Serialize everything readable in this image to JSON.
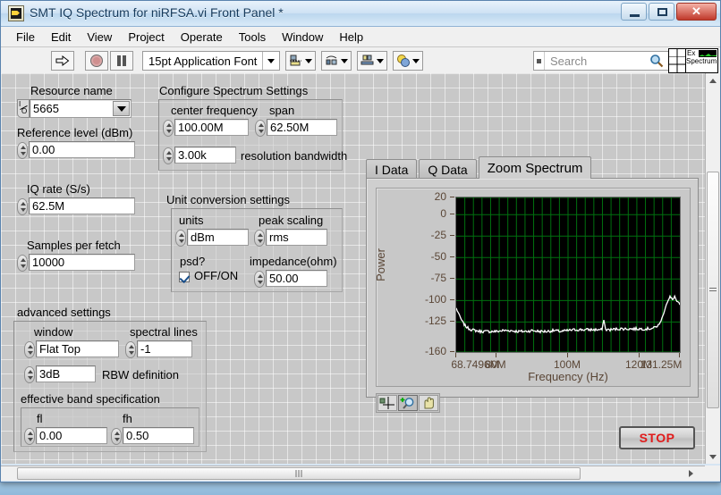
{
  "window": {
    "title": "SMT IQ Spectrum for niRFSA.vi Front Panel *",
    "icon_name": "labview-vi-icon",
    "minimize_label": "–",
    "maximize_label": "□",
    "close_label": "✕"
  },
  "menu": [
    "File",
    "Edit",
    "View",
    "Project",
    "Operate",
    "Tools",
    "Window",
    "Help"
  ],
  "toolbar": {
    "run_icon": "run-arrow-icon",
    "abort_icon": "abort-stop-icon",
    "pause_icon": "pause-icon",
    "font_selector": "15pt Application Font",
    "align_icon": "align-objects-icon",
    "distribute_icon": "distribute-objects-icon",
    "resize_icon": "resize-objects-icon",
    "reorder_icon": "reorder-objects-icon",
    "search_placeholder": "Search",
    "search_value": "",
    "search_icon": "magnifier-icon",
    "help_icon": "context-help-icon",
    "vi_icon_line1": "Ex",
    "vi_icon_line2": "Spectrum"
  },
  "controls": {
    "resource_name": {
      "label": "Resource name",
      "value": "5665",
      "type": "io-name-combo"
    },
    "reference_level": {
      "label": "Reference level (dBm)",
      "value": "0.00"
    },
    "iq_rate": {
      "label": "IQ rate (S/s)",
      "value": "62.5M"
    },
    "samples_per_fetch": {
      "label": "Samples per fetch",
      "value": "10000"
    }
  },
  "configure_spectrum": {
    "title": "Configure Spectrum Settings",
    "center_frequency": {
      "label": "center frequency",
      "value": "100.00M"
    },
    "span": {
      "label": "span",
      "value": "62.50M"
    },
    "resolution_bandwidth": {
      "label": "resolution bandwidth",
      "value": "3.00k"
    }
  },
  "unit_conversion": {
    "title": "Unit conversion settings",
    "units": {
      "label": "units",
      "value": "dBm"
    },
    "peak_scaling": {
      "label": "peak scaling",
      "value": "rms"
    },
    "psd": {
      "label": "psd?",
      "state_label": "OFF/ON",
      "checked": true
    },
    "impedance": {
      "label": "impedance(ohm)",
      "value": "50.00"
    }
  },
  "advanced_settings": {
    "title": "advanced settings",
    "window": {
      "label": "window",
      "value": "Flat Top"
    },
    "spectral_lines": {
      "label": "spectral lines",
      "value": "-1"
    },
    "rbw_definition": {
      "label": "RBW definition",
      "value": "3dB"
    },
    "effective_band": {
      "title": "effective band specification",
      "fl": {
        "label": "fl",
        "value": "0.00"
      },
      "fh": {
        "label": "fh",
        "value": "0.50"
      }
    }
  },
  "tabs": [
    {
      "label": "I Data",
      "active": false
    },
    {
      "label": "Q Data",
      "active": false
    },
    {
      "label": "Zoom Spectrum",
      "active": true
    }
  ],
  "graph_tools": {
    "cursor_icon": "cursor-crosshair-icon",
    "zoom_icon": "zoom-magnifier-icon",
    "pan_icon": "pan-hand-icon",
    "selected": "zoom-magnifier-icon"
  },
  "stop_button": {
    "label": "STOP"
  },
  "colors": {
    "plot_background": "#000000",
    "plot_grid": "#00700f",
    "trace": "#ffffff",
    "axis_text": "#5a4636",
    "panel_gray": "#c8c8c8",
    "stop_text": "#e01b1b"
  },
  "chart_data": {
    "type": "line",
    "title": "",
    "xlabel": "Frequency (Hz)",
    "ylabel": "Power",
    "xlim": [
      68.7496,
      131.25
    ],
    "ylim": [
      -160,
      20
    ],
    "xticks": [
      "68.7496M",
      "80M",
      "100M",
      "120M",
      "131.25M"
    ],
    "xtick_values": [
      68.7496,
      80,
      100,
      120,
      131.25
    ],
    "yticks": [
      "20",
      "0",
      "-25",
      "-50",
      "-75",
      "-100",
      "-125",
      "-160"
    ],
    "ytick_values": [
      20,
      0,
      -25,
      -50,
      -75,
      -100,
      -125,
      -160
    ],
    "grid": true,
    "legend": "none",
    "series": [
      {
        "name": "Zoom Spectrum",
        "x": [
          68.75,
          69.3,
          69.9,
          70.5,
          71.2,
          72.0,
          73.0,
          74.2,
          75.5,
          77.0,
          78.5,
          80.0,
          82.0,
          84.0,
          86.0,
          88.0,
          90.0,
          92.0,
          94.0,
          96.0,
          98.0,
          100.0,
          102.0,
          104.0,
          106.0,
          108.0,
          109.5,
          110.0,
          110.5,
          112.0,
          114.0,
          116.0,
          118.0,
          120.0,
          122.0,
          124.0,
          125.5,
          126.5,
          127.5,
          128.5,
          129.2,
          129.8,
          130.4,
          131.25
        ],
        "y": [
          -109,
          -114,
          -120,
          -125,
          -129,
          -132,
          -134,
          -135,
          -136,
          -136,
          -136,
          -136,
          -135,
          -135,
          -136,
          -136,
          -135,
          -136,
          -136,
          -135,
          -136,
          -135,
          -134,
          -134,
          -134,
          -134,
          -134,
          -122,
          -134,
          -134,
          -133,
          -133,
          -133,
          -133,
          -133,
          -132,
          -128,
          -118,
          -104,
          -96,
          -99,
          -95,
          -101,
          -105
        ]
      }
    ]
  }
}
